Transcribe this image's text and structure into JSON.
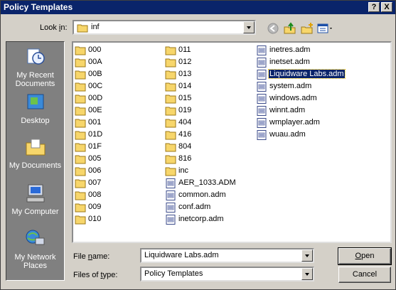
{
  "window": {
    "title": "Policy Templates",
    "help_label": "?",
    "close_label": "X"
  },
  "lookin": {
    "label_pre": "Look ",
    "label_ul": "i",
    "label_post": "n:",
    "value": "inf"
  },
  "places": [
    {
      "label": "My Recent Documents",
      "icon": "recent-documents-icon"
    },
    {
      "label": "Desktop",
      "icon": "desktop-icon"
    },
    {
      "label": "My Documents",
      "icon": "my-documents-icon"
    },
    {
      "label": "My Computer",
      "icon": "my-computer-icon"
    },
    {
      "label": "My Network Places",
      "icon": "network-places-icon"
    }
  ],
  "files": {
    "col1": [
      "000",
      "00A",
      "00B",
      "00C",
      "00D",
      "00E",
      "001",
      "01D",
      "01F",
      "005",
      "006",
      "007",
      "008",
      "009",
      "010"
    ],
    "col2": [
      {
        "name": "011",
        "type": "folder"
      },
      {
        "name": "012",
        "type": "folder"
      },
      {
        "name": "013",
        "type": "folder"
      },
      {
        "name": "014",
        "type": "folder"
      },
      {
        "name": "015",
        "type": "folder"
      },
      {
        "name": "019",
        "type": "folder"
      },
      {
        "name": "404",
        "type": "folder"
      },
      {
        "name": "416",
        "type": "folder"
      },
      {
        "name": "804",
        "type": "folder"
      },
      {
        "name": "816",
        "type": "folder"
      },
      {
        "name": "inc",
        "type": "folder"
      },
      {
        "name": "AER_1033.ADM",
        "type": "adm"
      },
      {
        "name": "common.adm",
        "type": "adm"
      },
      {
        "name": "conf.adm",
        "type": "adm"
      },
      {
        "name": "inetcorp.adm",
        "type": "adm"
      }
    ],
    "col3": [
      "inetres.adm",
      "inetset.adm",
      "Liquidware Labs.adm",
      "system.adm",
      "windows.adm",
      "winnt.adm",
      "wmplayer.adm",
      "wuau.adm"
    ],
    "selected": "Liquidware Labs.adm"
  },
  "filename": {
    "label_pre": "File ",
    "label_ul": "n",
    "label_post": "ame:",
    "value": "Liquidware Labs.adm"
  },
  "filetype": {
    "label_pre": "Files of ",
    "label_ul": "t",
    "label_post": "ype:",
    "value": "Policy Templates"
  },
  "buttons": {
    "open_ul": "O",
    "open_rest": "pen",
    "cancel": "Cancel"
  },
  "colors": {
    "selection": "#0a246a",
    "titlebar": "#0a246a",
    "face": "#d4d0c8",
    "folder": "#f7d66b"
  }
}
